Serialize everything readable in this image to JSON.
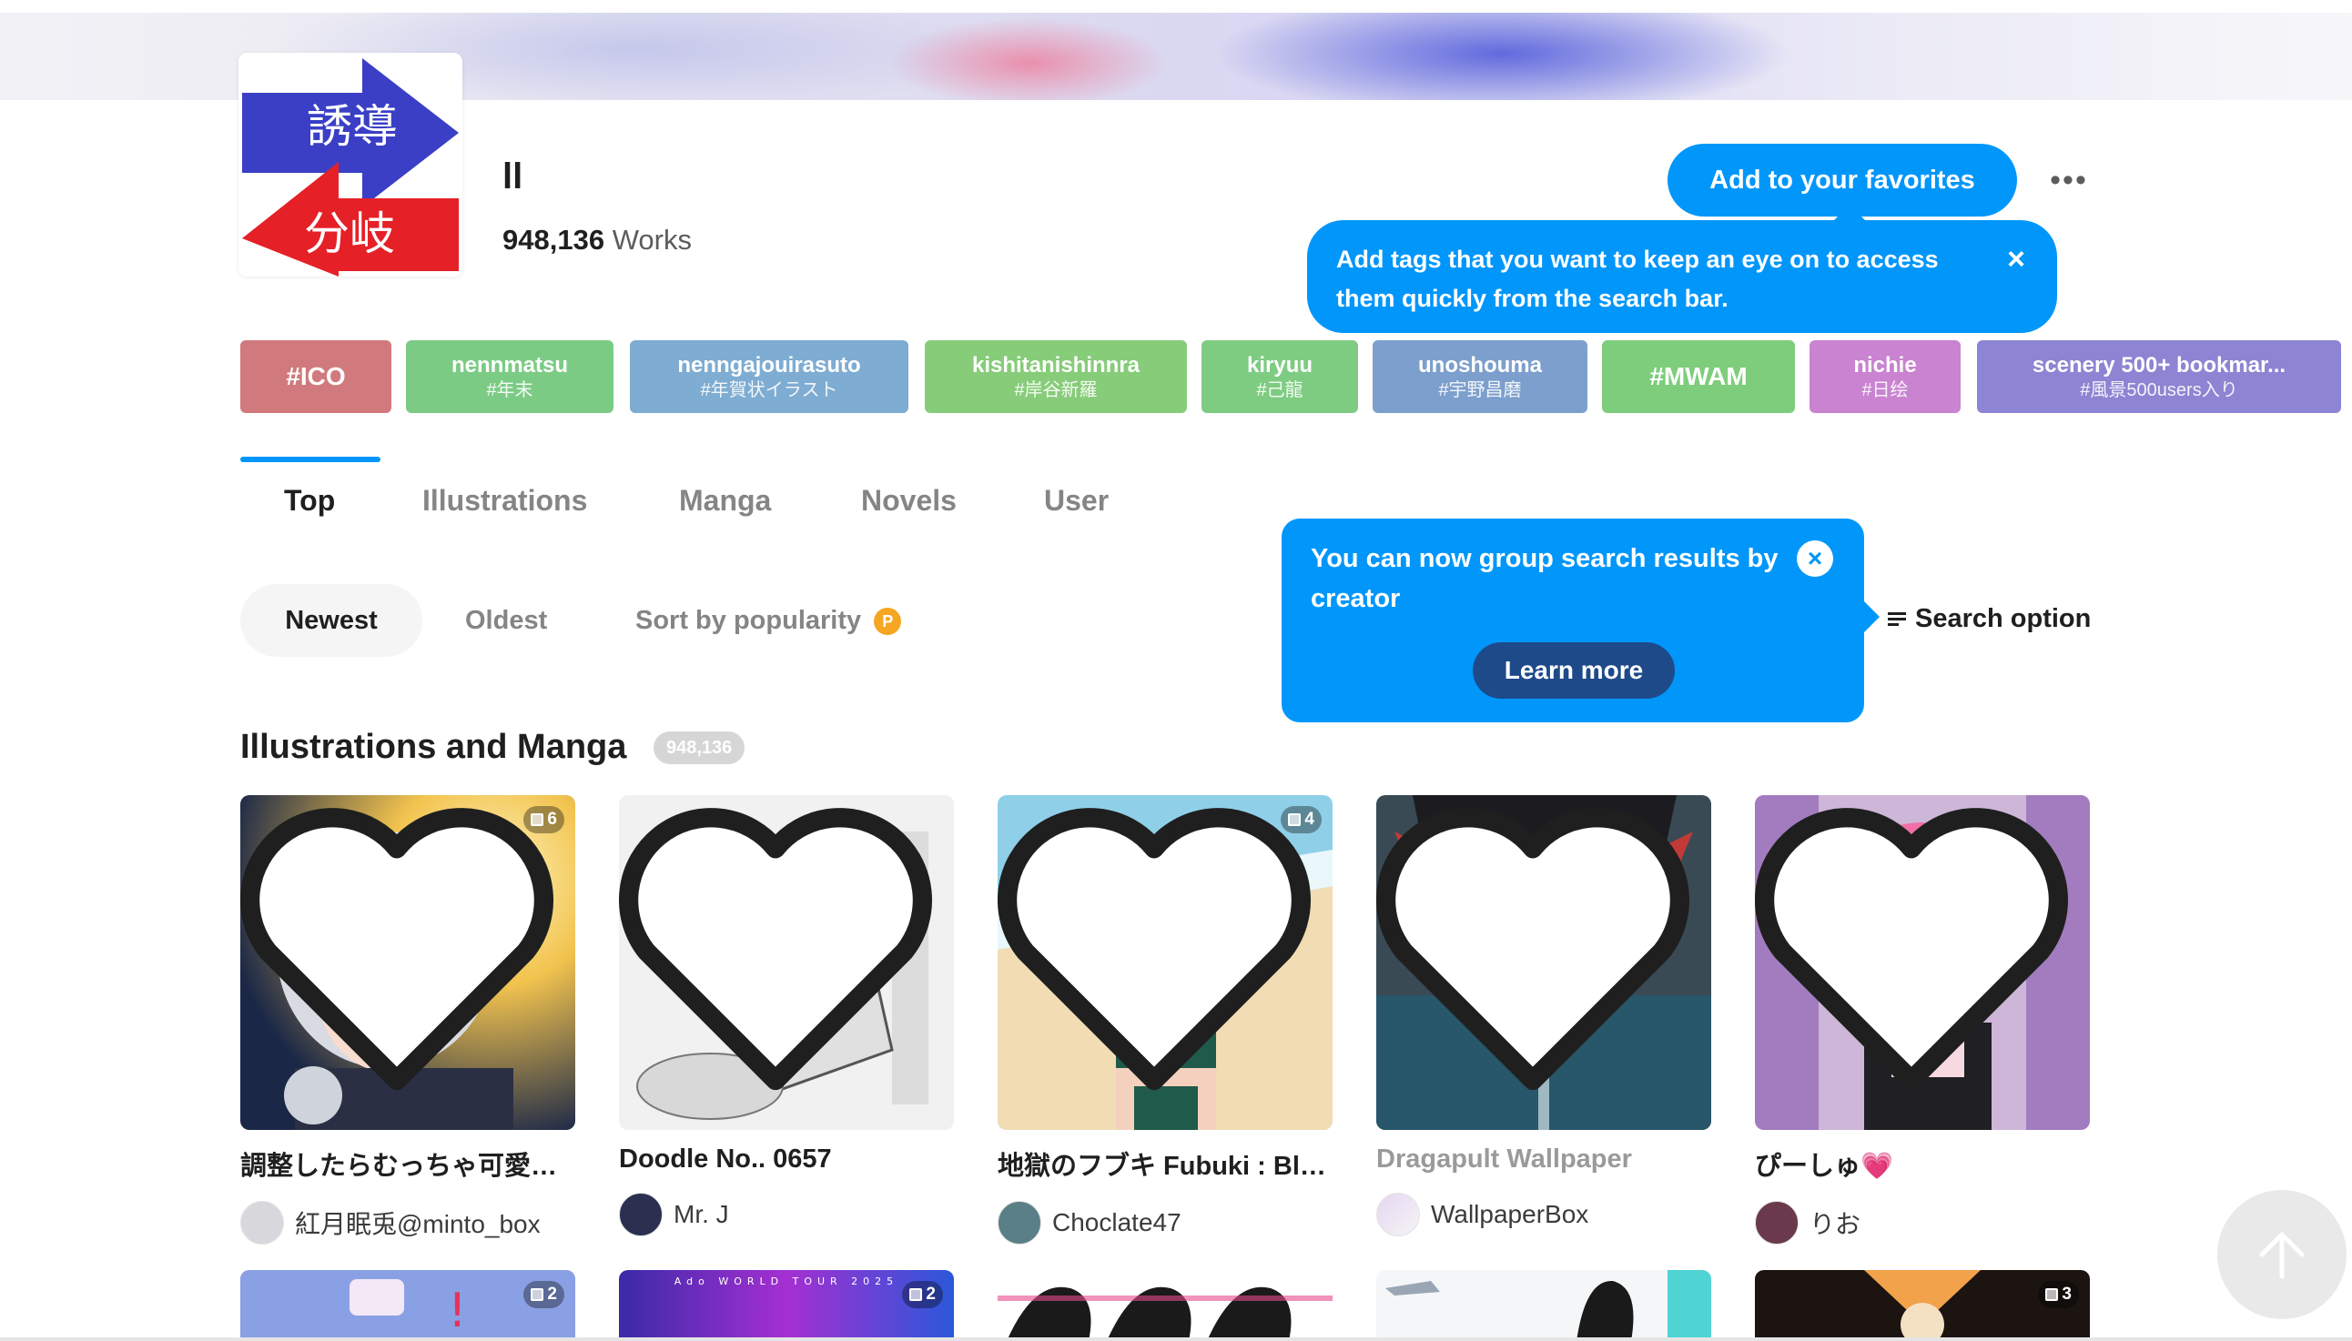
{
  "tag": {
    "logo_top_text": "誘導",
    "logo_bottom_text": "分岐",
    "title": "ll",
    "works_count": "948,136",
    "works_label": "Works",
    "favorite_button": "Add to your favorites",
    "more_button": "•••",
    "favorite_tip": "Add tags that you want to keep an eye on to access them quickly from the search bar.",
    "tip_close": "×"
  },
  "related_tags": [
    {
      "en": "#ICO",
      "jp": "",
      "color": "#d07a7d"
    },
    {
      "en": "nennmatsu",
      "jp": "#年末",
      "color": "#7ccb85"
    },
    {
      "en": "nenngajouirasuto",
      "jp": "#年賀状イラスト",
      "color": "#7eacd2"
    },
    {
      "en": "kishitanishinnra",
      "jp": "#岸谷新羅",
      "color": "#86cc79"
    },
    {
      "en": "kiryuu",
      "jp": "#己龍",
      "color": "#7ecc82"
    },
    {
      "en": "unoshouma",
      "jp": "#宇野昌磨",
      "color": "#7d9fcd"
    },
    {
      "en": "#MWAM",
      "jp": "",
      "color": "#7ecd7c"
    },
    {
      "en": "nichie",
      "jp": "#日绘",
      "color": "#c983d0"
    },
    {
      "en": "scenery 500+ bookmar...",
      "jp": "#風景500users入り",
      "color": "#8d84d3"
    }
  ],
  "tabs": [
    "Top",
    "Illustrations",
    "Manga",
    "Novels",
    "User"
  ],
  "sort": {
    "newest": "Newest",
    "oldest": "Oldest",
    "popularity": "Sort by popularity",
    "premium_badge": "P",
    "search_option": "Search option"
  },
  "group_tip": {
    "text": "You can now group search results by creator",
    "learn_more": "Learn more",
    "close": "×"
  },
  "section": {
    "title": "Illustrations and Manga",
    "count": "948,136"
  },
  "works": [
    {
      "title": "調整したらむっちゃ可愛い...",
      "user": "紅月眠兎@minto_box",
      "pages": "6",
      "muted": false
    },
    {
      "title": "Doodle No.. 0657",
      "user": "Mr. J",
      "pages": "",
      "muted": false
    },
    {
      "title": "地獄のフブキ Fubuki : Bliz...",
      "user": "Choclate47",
      "pages": "4",
      "muted": false
    },
    {
      "title": "Dragapult Wallpaper",
      "user": "WallpaperBox",
      "pages": "",
      "muted": true
    },
    {
      "title": "ぴーしゅ💗",
      "user": "りお",
      "pages": "",
      "muted": false
    }
  ],
  "works_row2_pages": [
    "2",
    "2",
    "",
    "",
    "3"
  ],
  "row2_banner_text": "Ado WORLD TOUR 2025"
}
